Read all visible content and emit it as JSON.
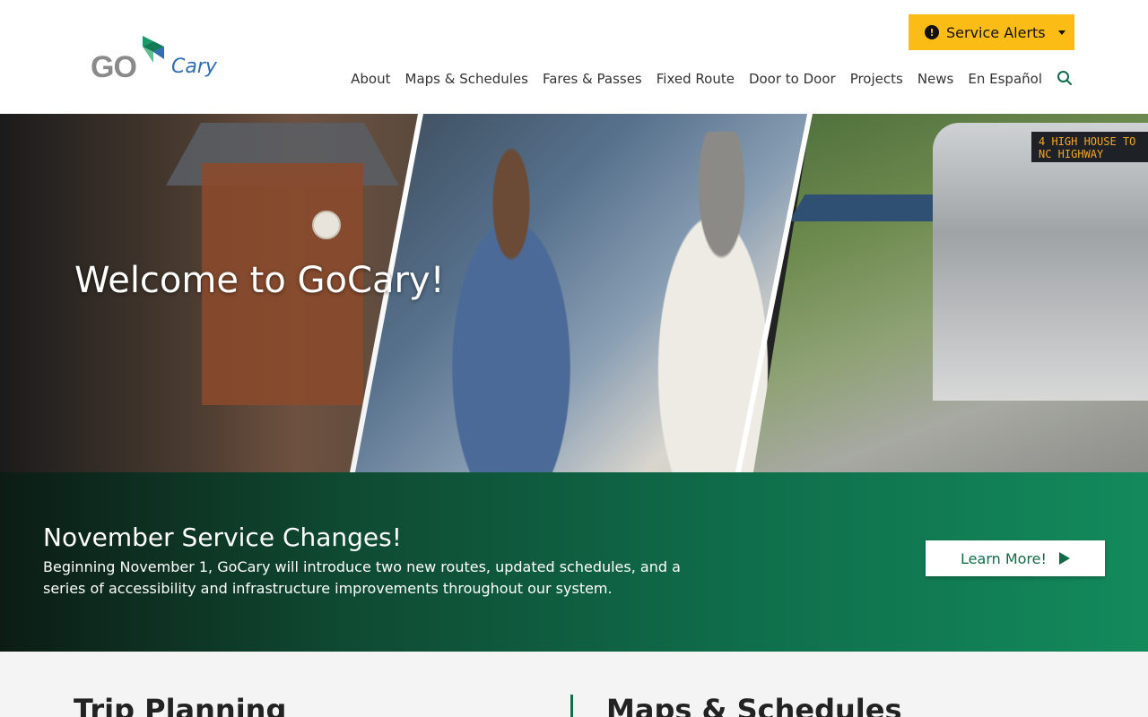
{
  "header": {
    "logo": {
      "go": "GO",
      "cary": "Cary"
    },
    "alerts_label": "Service Alerts",
    "alerts_icon": "!"
  },
  "nav": {
    "items": [
      "About",
      "Maps & Schedules",
      "Fares & Passes",
      "Fixed Route",
      "Door to Door",
      "Projects",
      "News",
      "En Español"
    ]
  },
  "hero": {
    "title": "Welcome to GoCary!",
    "bus_sign": "4 HIGH HOUSE TO NC HIGHWAY"
  },
  "banner": {
    "title": "November Service Changes!",
    "text": "Beginning November 1, GoCary will introduce two new routes, updated schedules, and a series of accessibility and infrastructure improvements throughout our system.",
    "button_label": "Learn More!"
  },
  "sections": {
    "left_title": "Trip Planning",
    "right_title": "Maps & Schedules"
  },
  "colors": {
    "accent_yellow": "#fcbc16",
    "brand_green": "#0f6e4b",
    "brand_blue": "#2f6db5"
  }
}
